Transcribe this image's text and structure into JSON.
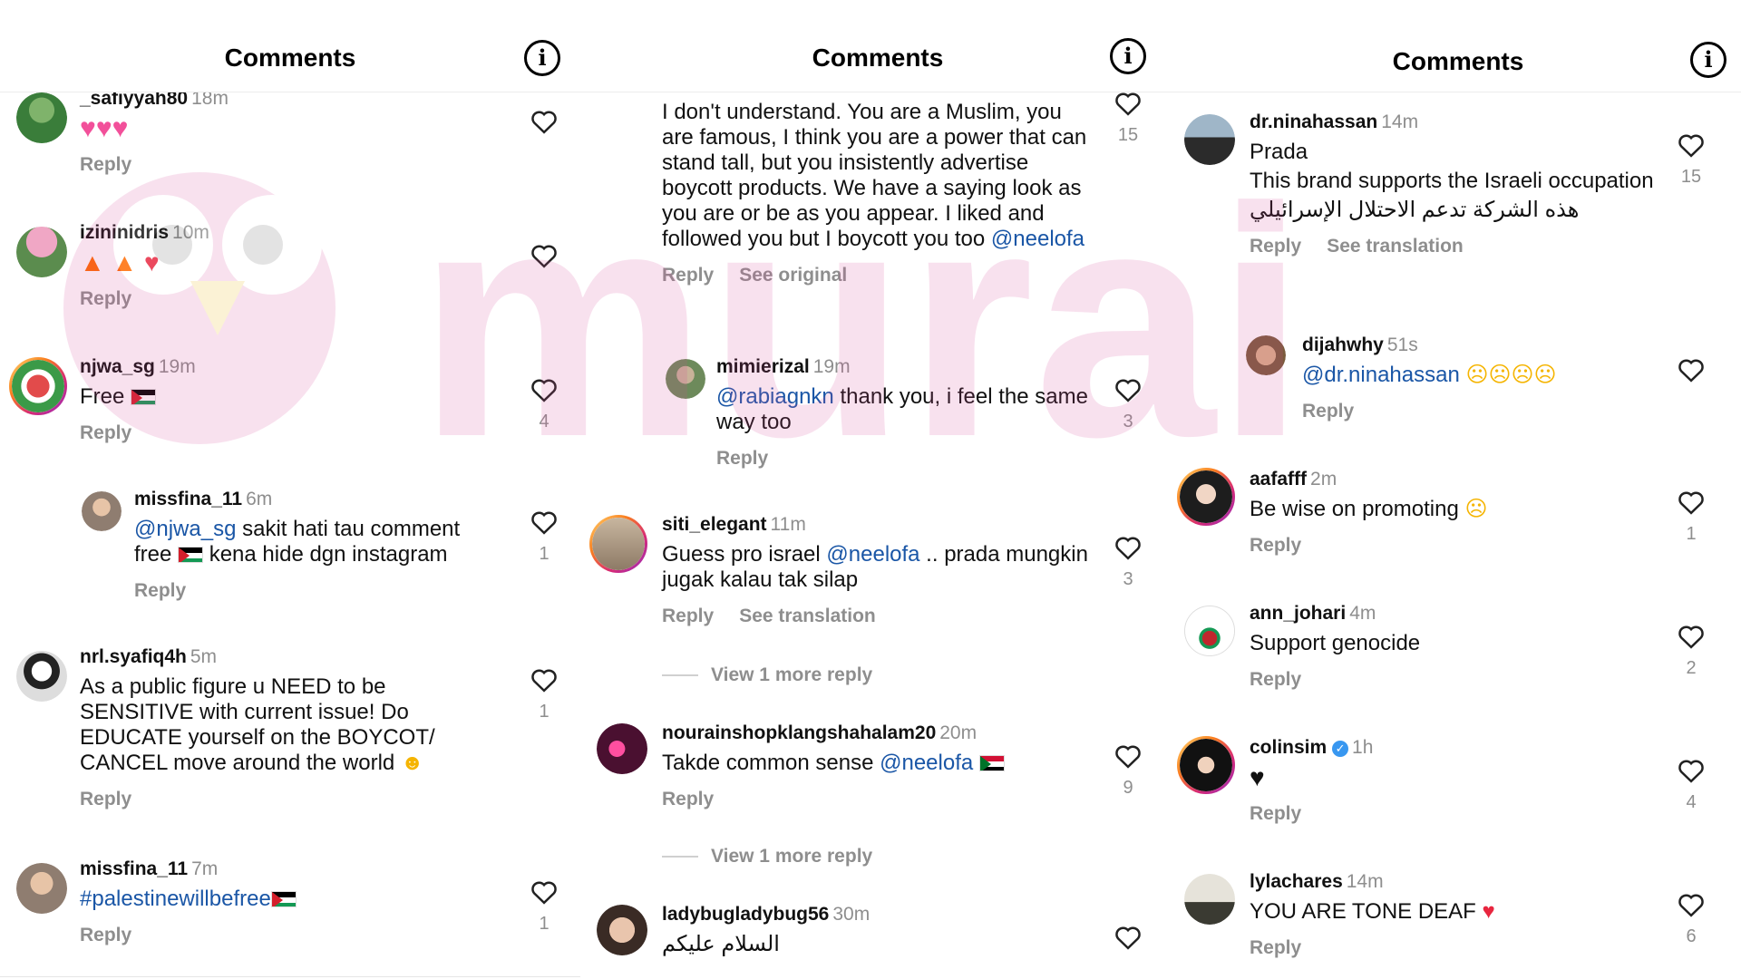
{
  "colors": {
    "mention": "#1a56a6",
    "muted": "#8e8e8e",
    "heart_red": "#e8263f",
    "pink": "#f2509a"
  },
  "actions": {
    "reply": "Reply",
    "see_original": "See original",
    "see_translation": "See translation",
    "view_more": "View 1 more reply"
  },
  "panels": [
    {
      "title": "Comments",
      "comments": [
        {
          "user": "_safiyyah80",
          "time": "18m",
          "text": "",
          "emoji": "pink-hearts x3",
          "likes": ""
        },
        {
          "user": "izininidris",
          "time": "10m",
          "text": "",
          "emoji": "fire fire red-heart",
          "likes": ""
        },
        {
          "user": "njwa_sg",
          "time": "19m",
          "text": "Free",
          "flag": "palestine",
          "likes": "4"
        },
        {
          "user": "missfina_11",
          "time": "6m",
          "mention": "@njwa_sg",
          "text": " sakit hati tau comment free",
          "text2": " kena hide dgn instagram",
          "flag": "palestine",
          "likes": "1"
        },
        {
          "user": "nrl.syafiq4h",
          "time": "5m",
          "text": "As a public figure u NEED to be SENSITIVE with current issue! Do EDUCATE yourself on the BOYCOT/ CANCEL move around the world",
          "emoji": "pleading-face",
          "likes": "1"
        },
        {
          "user": "missfina_11",
          "time": "7m",
          "text": "#palestinewillbefree",
          "flag": "palestine",
          "likes": "1"
        }
      ]
    },
    {
      "title": "Comments",
      "comments": [
        {
          "user": "",
          "time": "",
          "text": "I don't understand. You are a Muslim, you are famous, I think you are a power that can stand tall, but you insistently advertise boycott products. We have a saying look as you are or be as you appear. I liked and followed you but I boycott you too ",
          "mention": "@neelofa",
          "likes": "15"
        },
        {
          "user": "mimierizal",
          "time": "19m",
          "mention": "@rabiagnkn",
          "text": " thank you, i feel the same way too",
          "likes": "3"
        },
        {
          "user": "siti_elegant",
          "time": "11m",
          "text": "Guess pro israel ",
          "mention": "@neelofa",
          "text2": " .. prada mungkin jugak kalau tak silap",
          "likes": "3"
        },
        {
          "user": "nourainshopklangshahalam20",
          "time": "20m",
          "text": "Takde common sense ",
          "mention": "@neelofa",
          "flag": "sudan",
          "likes": "9"
        },
        {
          "user": "ladybugladybug56",
          "time": "30m",
          "text": "السلام عليكم",
          "likes": ""
        }
      ]
    },
    {
      "title": "Comments",
      "comments": [
        {
          "user": "dr.ninahassan",
          "time": "14m",
          "text": "Prada",
          "text2": "This brand supports the Israeli occupation",
          "text3": "هذه الشركة تدعم الاحتلال الإسرائيلي",
          "likes": "15"
        },
        {
          "user": "dijahwhy",
          "time": "51s",
          "mention": "@dr.ninahassan",
          "emoji": "crying x4",
          "likes": ""
        },
        {
          "user": "aafafff",
          "time": "2m",
          "text": "Be wise on promoting",
          "emoji": "sad-tear",
          "likes": "1"
        },
        {
          "user": "ann_johari",
          "time": "4m",
          "text": "Support genocide",
          "likes": "2"
        },
        {
          "user": "colinsim",
          "time": "1h",
          "verified": true,
          "emoji": "black-heart",
          "likes": "4"
        },
        {
          "user": "lylachares",
          "time": "14m",
          "text": "YOU ARE TONE DEAF",
          "emoji": "broken-heart",
          "likes": "6"
        }
      ]
    }
  ],
  "watermark_text": "murai"
}
